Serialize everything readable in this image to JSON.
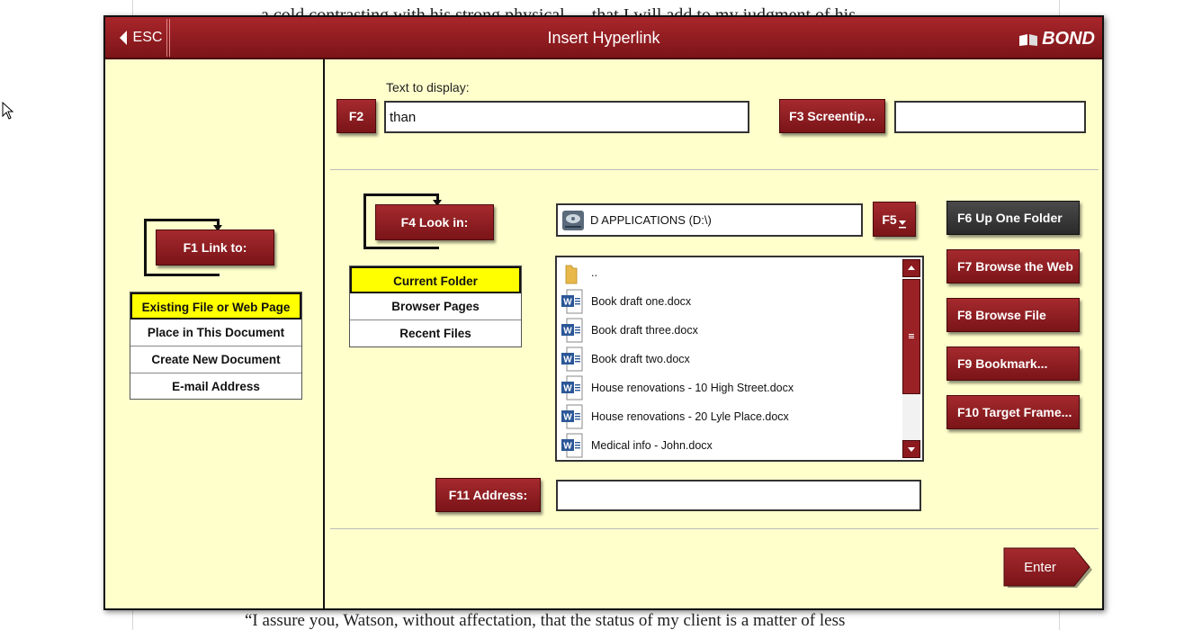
{
  "document": {
    "line_top": "a cold contrasting with his strong physical — that I will add to my judgment of his",
    "line_bottom": "“I assure you, Watson, without affectation, that the status of my client is a matter of less"
  },
  "dialog": {
    "esc_label": "ESC",
    "title": "Insert Hyperlink",
    "brand": "BOND"
  },
  "link_to": {
    "button_label": "F1 Link to:",
    "options": [
      {
        "label": "Existing File or Web Page",
        "selected": true
      },
      {
        "label": "Place in This Document",
        "selected": false
      },
      {
        "label": "Create New Document",
        "selected": false
      },
      {
        "label": "E-mail Address",
        "selected": false
      }
    ]
  },
  "text_to_display": {
    "label": "Text to display:",
    "button_label": "F2",
    "value": "than"
  },
  "screentip": {
    "button_label": "F3 Screentip...",
    "value": ""
  },
  "look_in": {
    "button_label": "F4 Look in:",
    "location": "D APPLICATIONS (D:\\)",
    "f5_label": "F5",
    "options": [
      {
        "label": "Current Folder",
        "selected": true
      },
      {
        "label": "Browser Pages",
        "selected": false
      },
      {
        "label": "Recent Files",
        "selected": false
      }
    ]
  },
  "files": [
    {
      "name": "..",
      "icon": "folder-icon"
    },
    {
      "name": "Book draft one.docx",
      "icon": "word-doc-icon"
    },
    {
      "name": "Book draft three.docx",
      "icon": "word-doc-icon"
    },
    {
      "name": "Book draft two.docx",
      "icon": "word-doc-icon"
    },
    {
      "name": "House renovations - 10 High Street.docx",
      "icon": "word-doc-icon"
    },
    {
      "name": "House renovations - 20 Lyle Place.docx",
      "icon": "word-doc-icon"
    },
    {
      "name": "Medical info - John.docx",
      "icon": "word-doc-icon"
    }
  ],
  "side_buttons": {
    "f6": "F6 Up One Folder",
    "f7": "F7 Browse the Web",
    "f8": "F8 Browse File",
    "f9": "F9 Bookmark...",
    "f10": "F10 Target Frame..."
  },
  "address": {
    "button_label": "F11 Address:",
    "value": ""
  },
  "enter_label": "Enter",
  "colors": {
    "dialog_bg": "#ffffcc",
    "button_red": "#8c1a1e",
    "button_dark": "#333333",
    "selected_yellow": "#ffff00"
  }
}
